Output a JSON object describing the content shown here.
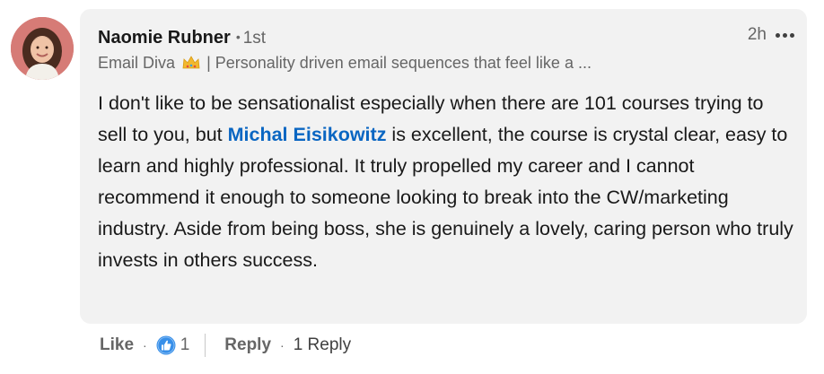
{
  "author": {
    "name": "Naomie Rubner",
    "degree": "1st",
    "headline_pre": "Email Diva",
    "headline_post": "| Personality driven email sequences that feel like a ..."
  },
  "meta": {
    "time": "2h"
  },
  "comment": {
    "text_before": "I don't like to be sensationalist especially when there are 101 courses trying to sell to you, but ",
    "mention": "Michal Eisikowitz",
    "text_after": " is excellent, the course is crystal clear, easy to learn and highly professional. It truly propelled my career and I cannot recommend it enough to someone looking to break into the CW/marketing industry. Aside from being boss, she is genuinely a lovely, caring person who truly invests in others success."
  },
  "actions": {
    "like_label": "Like",
    "like_count": "1",
    "reply_label": "Reply",
    "reply_count": "1 Reply"
  },
  "icons": {
    "avatar": "avatar-photo",
    "crown": "crown-emoji",
    "more": "more-options-icon",
    "like_reaction": "like-reaction-icon"
  },
  "colors": {
    "bubble_bg": "#f2f2f2",
    "mention": "#0a66c2",
    "muted": "#666666",
    "reaction_blue": "#378fe9"
  }
}
